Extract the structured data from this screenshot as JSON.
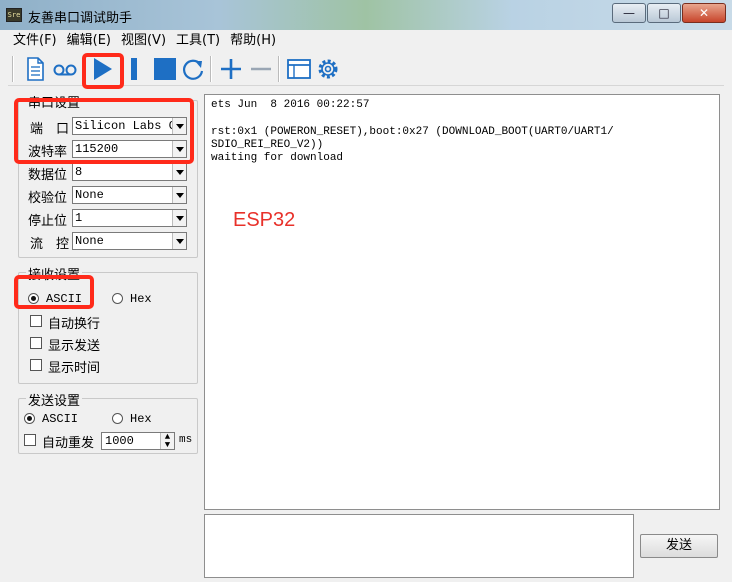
{
  "window": {
    "title": "友善串口调试助手",
    "app_icon_text": "Sre"
  },
  "window_buttons": {
    "minimize": "—",
    "maximize": "□",
    "close": "✕"
  },
  "menu": [
    "文件(F)",
    "编辑(E)",
    "视图(V)",
    "工具(T)",
    "帮助(H)"
  ],
  "serial_settings": {
    "title": "串口设置",
    "port_label": "端　口",
    "port_value": "Silicon Labs CP",
    "baud_label": "波特率",
    "baud_value": "115200",
    "databits_label": "数据位",
    "databits_value": "8",
    "parity_label": "校验位",
    "parity_value": "None",
    "stopbits_label": "停止位",
    "stopbits_value": "1",
    "flow_label": "流　控",
    "flow_value": "None"
  },
  "receive_settings": {
    "title": "接收设置",
    "ascii": "ASCII",
    "hex": "Hex",
    "auto_wrap": "自动换行",
    "show_send": "显示发送",
    "show_time": "显示时间"
  },
  "send_settings": {
    "title": "发送设置",
    "ascii": "ASCII",
    "hex": "Hex",
    "auto_resend": "自动重发",
    "interval": "1000",
    "unit": "ms"
  },
  "terminal": {
    "lines": [
      "ets Jun  8 2016 00:22:57",
      "",
      "rst:0x1 (POWERON_RESET),boot:0x27 (DOWNLOAD_BOOT(UART0/UART1/",
      "SDIO_REI_REO_V2))",
      "waiting for download"
    ],
    "annotation": "ESP32"
  },
  "send_button": "发送",
  "colors": {
    "highlight": "#ff2a1a",
    "icon_blue": "#1e6fc4",
    "annotation": "#e8312a"
  }
}
